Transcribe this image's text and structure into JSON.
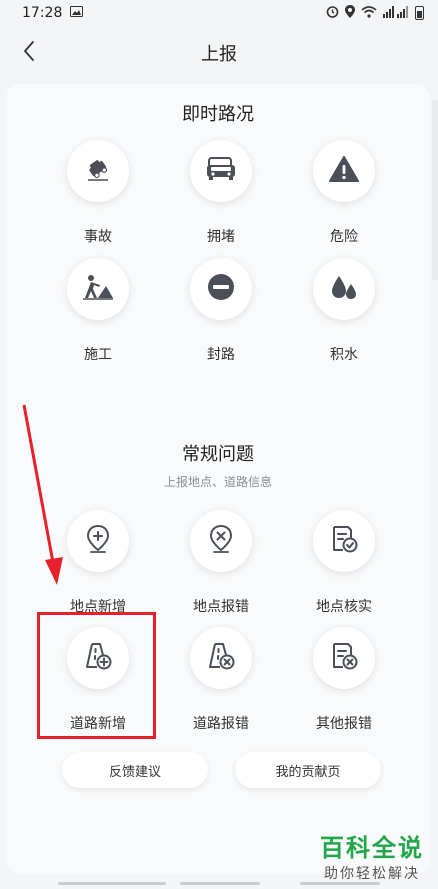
{
  "status_bar": {
    "time": "17:28",
    "icons": [
      "image-icon",
      "alarm-icon",
      "location-icon",
      "wifi-icon",
      "signal-icon",
      "battery-icon"
    ]
  },
  "header": {
    "title": "上报",
    "back_icon": "chevron-left-icon"
  },
  "traffic": {
    "title": "即时路况",
    "items": [
      {
        "label": "事故",
        "icon": "accident-icon"
      },
      {
        "label": "拥堵",
        "icon": "traffic-jam-icon"
      },
      {
        "label": "危险",
        "icon": "danger-icon"
      },
      {
        "label": "施工",
        "icon": "construction-icon"
      },
      {
        "label": "封路",
        "icon": "road-closed-icon"
      },
      {
        "label": "积水",
        "icon": "water-icon"
      }
    ]
  },
  "common": {
    "title": "常规问题",
    "subtitle": "上报地点、道路信息",
    "items": [
      {
        "label": "地点新增",
        "icon": "add-location-icon"
      },
      {
        "label": "地点报错",
        "icon": "location-error-icon"
      },
      {
        "label": "地点核实",
        "icon": "verify-document-icon"
      },
      {
        "label": "道路新增",
        "icon": "add-road-icon"
      },
      {
        "label": "道路报错",
        "icon": "road-error-icon"
      },
      {
        "label": "其他报错",
        "icon": "other-error-icon"
      }
    ]
  },
  "buttons": {
    "feedback": "反馈建议",
    "my_contributions": "我的贡献页"
  },
  "watermark": {
    "title": "百科全说",
    "subtitle": "助你轻松解决"
  },
  "colors": {
    "annotation": "#e8202a",
    "icon": "#4a4f58",
    "watermark": "#22a64a"
  }
}
